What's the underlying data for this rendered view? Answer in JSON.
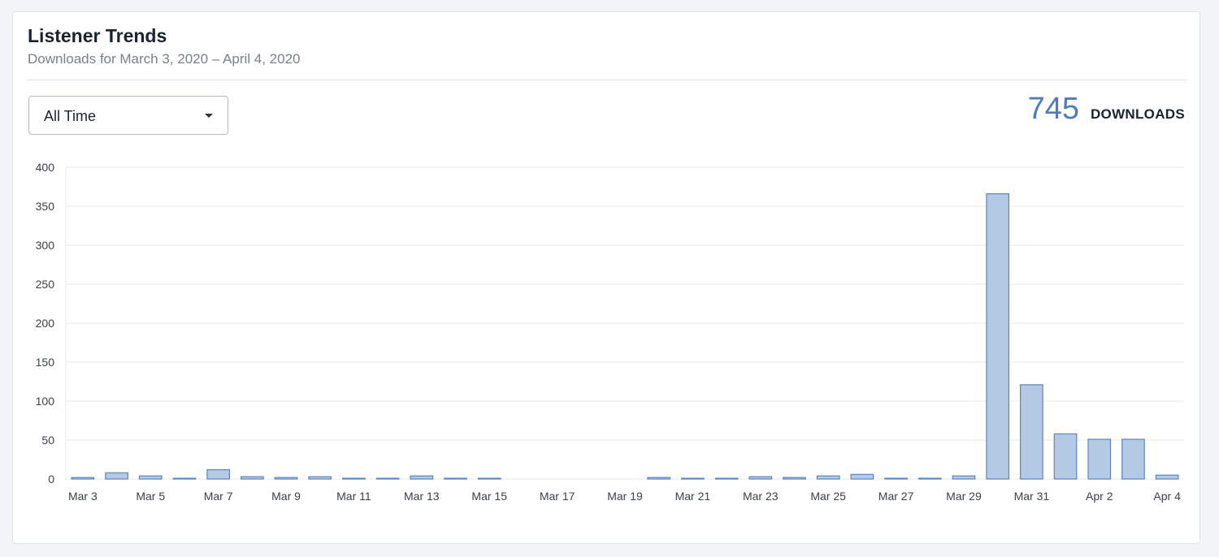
{
  "header": {
    "title": "Listener Trends",
    "subtitle": "Downloads for March 3, 2020 – April 4, 2020"
  },
  "filter": {
    "selected": "All Time"
  },
  "summary": {
    "total": "745",
    "label": "DOWNLOADS"
  },
  "colors": {
    "bar_fill": "#b3c9e4",
    "bar_stroke": "#5d85bd",
    "accent": "#4f7cb8",
    "grid": "#e6e8ec"
  },
  "chart_data": {
    "type": "bar",
    "title": "",
    "xlabel": "",
    "ylabel": "",
    "ylim": [
      0,
      400
    ],
    "yticks": [
      0,
      50,
      100,
      150,
      200,
      250,
      300,
      350,
      400
    ],
    "grid": true,
    "categories": [
      "Mar 3",
      "Mar 4",
      "Mar 5",
      "Mar 6",
      "Mar 7",
      "Mar 8",
      "Mar 9",
      "Mar 10",
      "Mar 11",
      "Mar 12",
      "Mar 13",
      "Mar 14",
      "Mar 15",
      "Mar 16",
      "Mar 17",
      "Mar 18",
      "Mar 19",
      "Mar 20",
      "Mar 21",
      "Mar 22",
      "Mar 23",
      "Mar 24",
      "Mar 25",
      "Mar 26",
      "Mar 27",
      "Mar 28",
      "Mar 29",
      "Mar 30",
      "Mar 31",
      "Apr 1",
      "Apr 2",
      "Apr 3",
      "Apr 4"
    ],
    "xtick_labels": [
      "Mar 3",
      "Mar 5",
      "Mar 7",
      "Mar 9",
      "Mar 11",
      "Mar 13",
      "Mar 15",
      "Mar 17",
      "Mar 19",
      "Mar 21",
      "Mar 23",
      "Mar 25",
      "Mar 27",
      "Mar 29",
      "Mar 31",
      "Apr 2",
      "Apr 4"
    ],
    "series": [
      {
        "values": [
          2,
          8,
          4,
          1,
          12,
          3,
          2,
          3,
          1,
          1,
          4,
          1,
          1,
          0,
          0,
          0,
          0,
          2,
          1,
          1,
          3,
          2,
          4,
          6,
          1,
          1,
          4,
          366,
          121,
          58,
          51,
          51,
          5
        ]
      }
    ]
  }
}
